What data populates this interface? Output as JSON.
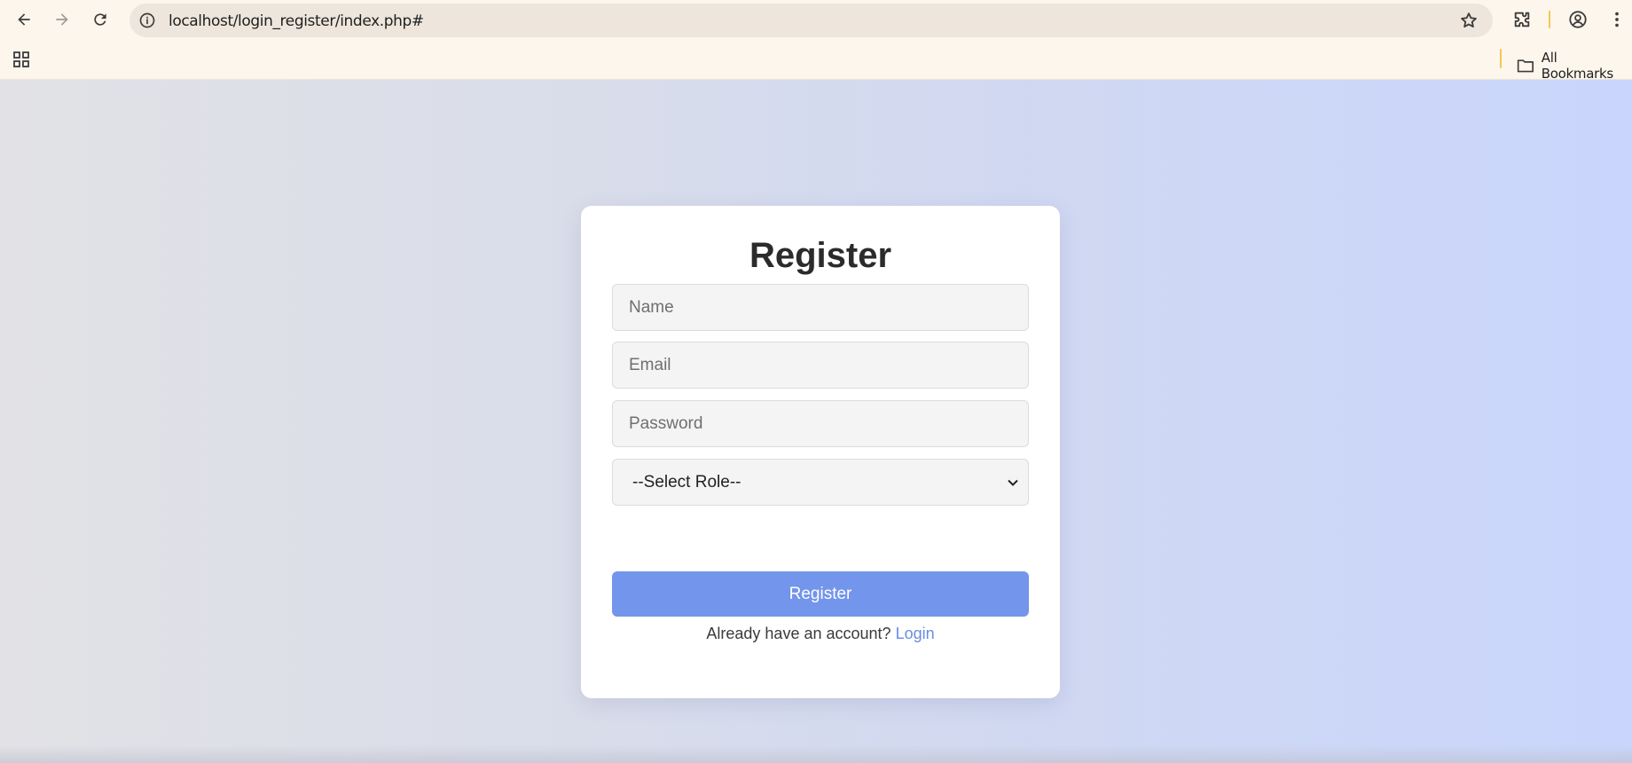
{
  "browser": {
    "url": "localhost/login_register/index.php#",
    "bookmarks_label": "All Bookmarks",
    "icons": [
      "back-icon",
      "forward-icon",
      "reload-icon",
      "site-info-icon",
      "star-icon",
      "extensions-icon",
      "profile-icon",
      "menu-icon",
      "apps-icon",
      "folder-icon"
    ]
  },
  "form": {
    "title": "Register",
    "name_placeholder": "Name",
    "email_placeholder": "Email",
    "password_placeholder": "Password",
    "role_selected": "--Select Role--",
    "submit_label": "Register",
    "footer_prompt": "Already have an account?",
    "login_link": "Login"
  },
  "colors": {
    "button": "#7395eb",
    "link": "#6a8be6",
    "background_left": "#e2e2e6",
    "background_right": "#c9d5fc"
  }
}
